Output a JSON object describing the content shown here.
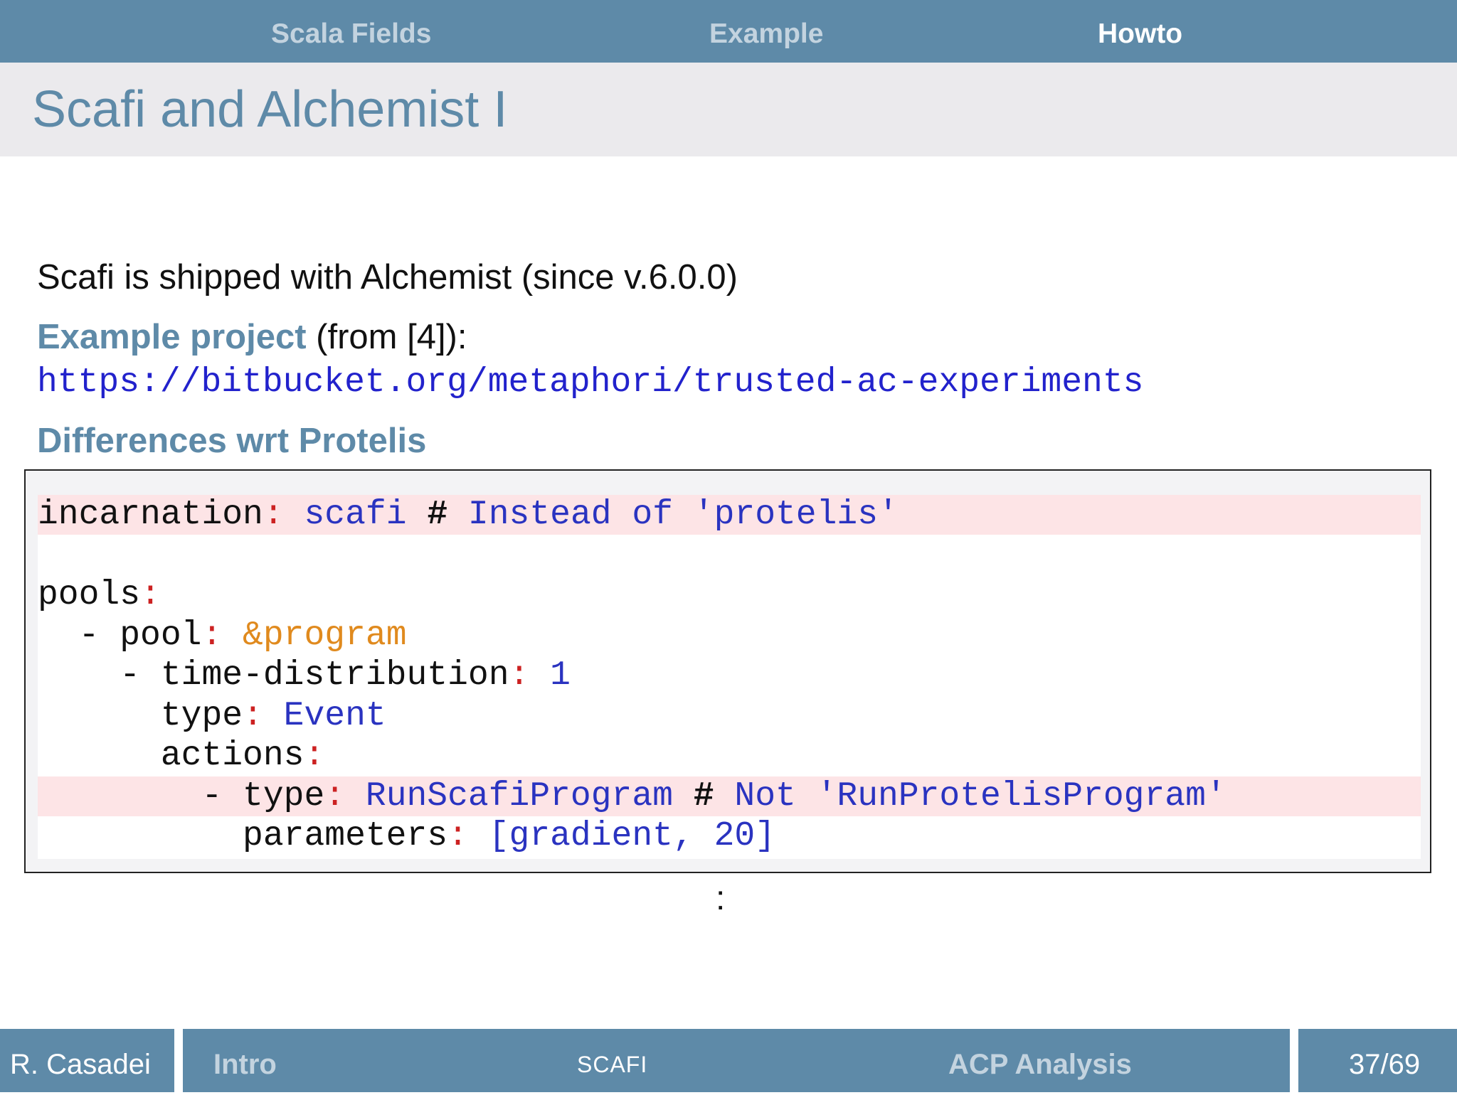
{
  "nav": {
    "sections": [
      "Scala Fields",
      "Example",
      "Howto"
    ],
    "active": "Howto"
  },
  "slide": {
    "title": "Scafi and Alchemist I",
    "intro": "Scafi is shipped with Alchemist (since v.6.0.0)",
    "example_label": "Example project",
    "example_suffix": " (from [4]):",
    "url": "https://bitbucket.org/metaphori/trusted-ac-experiments",
    "differences_heading": "Differences wrt Protelis",
    "continuation": ":"
  },
  "code": {
    "line1": {
      "key": "incarnation",
      "colon": ":",
      "value": " scafi ",
      "hash": "#",
      "comment": " Instead of 'protelis'"
    },
    "line3": {
      "key": "pools",
      "colon": ":"
    },
    "line4": {
      "prefix": "  - ",
      "key": "pool",
      "colon": ":",
      "anchor": " &program"
    },
    "line5": {
      "prefix": "    - ",
      "key": "time-distribution",
      "colon": ":",
      "value": " 1"
    },
    "line6": {
      "prefix": "      ",
      "key": "type",
      "colon": ":",
      "value": " Event"
    },
    "line7": {
      "prefix": "      ",
      "key": "actions",
      "colon": ":"
    },
    "line8": {
      "prefix": "        - ",
      "key": "type",
      "colon": ":",
      "value": " RunScafiProgram ",
      "hash": "#",
      "comment": " Not 'RunProtelisProgram'"
    },
    "line9": {
      "prefix": "          ",
      "key": "parameters",
      "colon": ":",
      "value": " [gradient, 20]"
    }
  },
  "footer": {
    "author": "R. Casadei",
    "section_left": "Intro",
    "section_center": "SCAFI",
    "section_right": "ACP Analysis",
    "page": "37/69"
  },
  "colors": {
    "accent": "#5e8aa8",
    "title_band": "#ebeaed",
    "code_highlight": "#fde4e6",
    "link": "#2222cc"
  }
}
